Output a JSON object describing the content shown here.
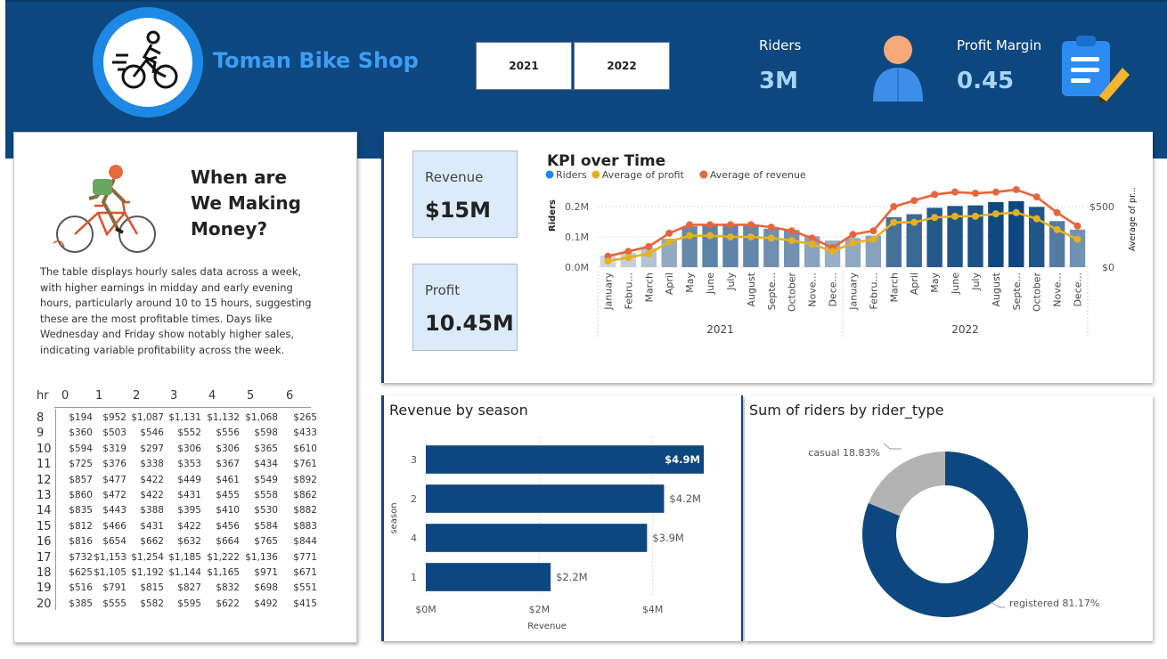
{
  "header": {
    "brand": "Toman Bike Shop",
    "logo_icon": "cyclist-icon",
    "year_buttons": [
      "2021",
      "2022"
    ],
    "riders_label": "Riders",
    "riders_value": "3M",
    "margin_label": "Profit Margin",
    "margin_value": "0.45",
    "accent": "#0d4780"
  },
  "left_panel": {
    "title_lines": [
      "When are",
      "We Making",
      "Money?"
    ],
    "description": "The table displays hourly sales data across a week, with higher earnings in midday and early evening hours, particularly around 10 to 15 hours, suggesting these are the most profitable times. Days like Wednesday and Friday show notably higher sales, indicating variable profitability across the week.",
    "table": {
      "corner": "hr",
      "days": [
        "0",
        "1",
        "2",
        "3",
        "4",
        "5",
        "6"
      ],
      "rows": [
        {
          "hr": "8",
          "vals": [
            "$194",
            "$952",
            "$1,087",
            "$1,131",
            "$1,132",
            "$1,068",
            "$265"
          ]
        },
        {
          "hr": "9",
          "vals": [
            "$360",
            "$503",
            "$546",
            "$552",
            "$556",
            "$598",
            "$433"
          ]
        },
        {
          "hr": "10",
          "vals": [
            "$594",
            "$319",
            "$297",
            "$306",
            "$306",
            "$365",
            "$610"
          ]
        },
        {
          "hr": "11",
          "vals": [
            "$725",
            "$376",
            "$338",
            "$353",
            "$367",
            "$434",
            "$761"
          ]
        },
        {
          "hr": "12",
          "vals": [
            "$857",
            "$477",
            "$422",
            "$449",
            "$461",
            "$549",
            "$892"
          ]
        },
        {
          "hr": "13",
          "vals": [
            "$860",
            "$472",
            "$422",
            "$431",
            "$455",
            "$558",
            "$862"
          ]
        },
        {
          "hr": "14",
          "vals": [
            "$835",
            "$443",
            "$388",
            "$395",
            "$410",
            "$530",
            "$882"
          ]
        },
        {
          "hr": "15",
          "vals": [
            "$812",
            "$466",
            "$431",
            "$422",
            "$456",
            "$584",
            "$883"
          ]
        },
        {
          "hr": "16",
          "vals": [
            "$816",
            "$654",
            "$662",
            "$632",
            "$664",
            "$765",
            "$844"
          ]
        },
        {
          "hr": "17",
          "vals": [
            "$732",
            "$1,153",
            "$1,254",
            "$1,185",
            "$1,222",
            "$1,136",
            "$771"
          ]
        },
        {
          "hr": "18",
          "vals": [
            "$625",
            "$1,105",
            "$1,192",
            "$1,144",
            "$1,165",
            "$971",
            "$671"
          ]
        },
        {
          "hr": "19",
          "vals": [
            "$516",
            "$791",
            "$815",
            "$827",
            "$832",
            "$698",
            "$551"
          ]
        },
        {
          "hr": "20",
          "vals": [
            "$385",
            "$555",
            "$582",
            "$595",
            "$622",
            "$492",
            "$415"
          ]
        }
      ]
    }
  },
  "tiles": {
    "revenue_label": "Revenue",
    "revenue_value": "$15M",
    "profit_label": "Profit",
    "profit_value": "10.45M"
  },
  "chart_data": [
    {
      "id": "kpi",
      "type": "bar",
      "title": "KPI over Time",
      "legend": [
        "Riders",
        "Average of profit",
        "Average of revenue"
      ],
      "legend_placement": "top-left",
      "colors": {
        "riders": "#1e88e5",
        "profit": "#e3b21f",
        "revenue": "#e8643c",
        "bar_dark": "#0d4780",
        "bar_light": "#cfd6de"
      },
      "ylabel": "Riders",
      "y2label": "Average of pr...",
      "ylim": [
        0,
        0.2
      ],
      "yticks": [
        "0.0M",
        "0.1M",
        "0.2M"
      ],
      "y2lim": [
        0,
        500
      ],
      "y2ticks": [
        "$0",
        "$500"
      ],
      "groups": [
        "2021",
        "2022"
      ],
      "categories": [
        "January",
        "Febru...",
        "March",
        "April",
        "May",
        "June",
        "July",
        "August",
        "Septe...",
        "October",
        "Nove...",
        "Dece...",
        "January",
        "Febru...",
        "March",
        "April",
        "May",
        "June",
        "July",
        "August",
        "Septe...",
        "October",
        "Nove...",
        "Dece..."
      ],
      "riders": [
        0.038,
        0.047,
        0.063,
        0.094,
        0.135,
        0.143,
        0.141,
        0.137,
        0.127,
        0.123,
        0.102,
        0.088,
        0.096,
        0.104,
        0.165,
        0.175,
        0.196,
        0.202,
        0.204,
        0.215,
        0.218,
        0.199,
        0.152,
        0.124
      ],
      "profit": [
        50,
        80,
        110,
        210,
        260,
        260,
        250,
        250,
        240,
        220,
        190,
        130,
        200,
        230,
        370,
        370,
        410,
        420,
        420,
        440,
        450,
        400,
        310,
        230
      ],
      "revenue": [
        90,
        130,
        170,
        280,
        350,
        350,
        350,
        350,
        330,
        300,
        240,
        160,
        270,
        300,
        500,
        550,
        600,
        620,
        610,
        620,
        640,
        580,
        450,
        340
      ]
    },
    {
      "id": "season",
      "type": "bar",
      "orientation": "horizontal",
      "title": "Revenue by season",
      "xlabel": "Revenue",
      "ylabel": "season",
      "xlim": [
        0,
        4.9
      ],
      "xticks": [
        "$0M",
        "$2M",
        "$4M"
      ],
      "categories": [
        "3",
        "2",
        "4",
        "1"
      ],
      "values": [
        4.9,
        4.2,
        3.9,
        2.2
      ],
      "labels": [
        "$4.9M",
        "$4.2M",
        "$3.9M",
        "$2.2M"
      ],
      "color": "#0d4780"
    },
    {
      "id": "riders",
      "type": "pie",
      "variant": "donut",
      "title": "Sum of riders by rider_type",
      "slices": [
        {
          "name": "registered",
          "value": 81.17,
          "label": "registered 81.17%",
          "color": "#0d4780"
        },
        {
          "name": "casual",
          "value": 18.83,
          "label": "casual 18.83%",
          "color": "#b3b3b3"
        }
      ]
    }
  ]
}
